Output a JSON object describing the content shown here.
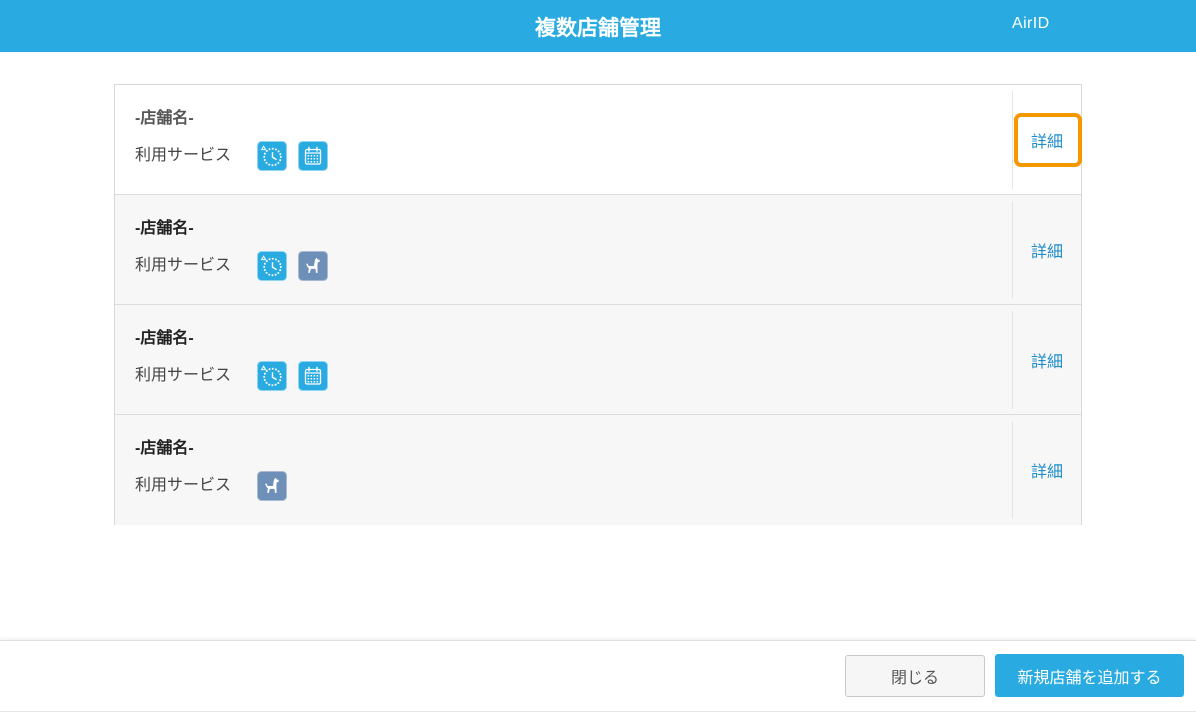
{
  "header": {
    "title": "複数店舗管理",
    "account_label": "AirID"
  },
  "colors": {
    "header_bg": "#29abe2",
    "service_blue": "#29abe2",
    "service_slate": "#6e8fb8",
    "link": "#1f8dcc",
    "highlight": "#f39800",
    "primary_button": "#29abe2"
  },
  "stores": [
    {
      "name": "-店舗名-",
      "services_label": "利用サービス",
      "services": [
        "clock-icon",
        "calendar-icon"
      ],
      "detail_label": "詳細",
      "highlighted": true
    },
    {
      "name": "-店舗名-",
      "services_label": "利用サービス",
      "services": [
        "clock-icon",
        "dog-icon"
      ],
      "detail_label": "詳細",
      "highlighted": false
    },
    {
      "name": "-店舗名-",
      "services_label": "利用サービス",
      "services": [
        "clock-icon",
        "calendar-icon"
      ],
      "detail_label": "詳細",
      "highlighted": false
    },
    {
      "name": "-店舗名-",
      "services_label": "利用サービス",
      "services": [
        "dog-icon"
      ],
      "detail_label": "詳細",
      "highlighted": false
    }
  ],
  "footer": {
    "close_label": "閉じる",
    "add_store_label": "新規店舗を追加する"
  }
}
